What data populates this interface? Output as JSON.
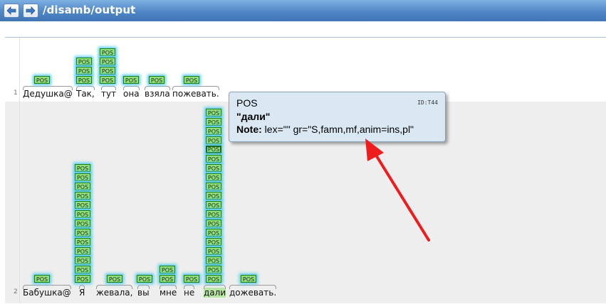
{
  "header": {
    "back_icon": "arrow-left-icon",
    "forward_icon": "arrow-right-icon",
    "path": "/disamb/output"
  },
  "tag_label": "POS",
  "sentences": [
    {
      "number": "1",
      "words": [
        {
          "text": "Дедушка@",
          "tags": 1
        },
        {
          "text": "Так,",
          "tags": 3
        },
        {
          "text": "тут",
          "tags": 4
        },
        {
          "text": "она",
          "tags": 1
        },
        {
          "text": "взяла",
          "tags": 1
        },
        {
          "text": "пожевать.",
          "tags": 1
        }
      ]
    },
    {
      "number": "2",
      "words": [
        {
          "text": "Бабушка@",
          "tags": 1
        },
        {
          "text": "Я",
          "tags": 13
        },
        {
          "text": "жевала,",
          "tags": 1
        },
        {
          "text": "вы",
          "tags": 1
        },
        {
          "text": "мне",
          "tags": 2
        },
        {
          "text": "не",
          "tags": 1
        },
        {
          "text": "дали",
          "tags": 20,
          "selected": true
        },
        {
          "text": "дожевать.",
          "tags": 1
        }
      ]
    }
  ],
  "tooltip": {
    "type": "POS",
    "id": "ID:T44",
    "text": "\"дали\"",
    "note_label": "Note:",
    "note_value": "lex=\"\" gr=\"S,famn,mf,anim=ins,pl\""
  },
  "colors": {
    "header": "#4f86c4",
    "tag_fill": "#90e07a",
    "tag_glow": "#55cce8",
    "selected_word": "#b8e7a6",
    "tooltip_bg": "#d9e8f3",
    "arrow": "#ee1c1c"
  }
}
